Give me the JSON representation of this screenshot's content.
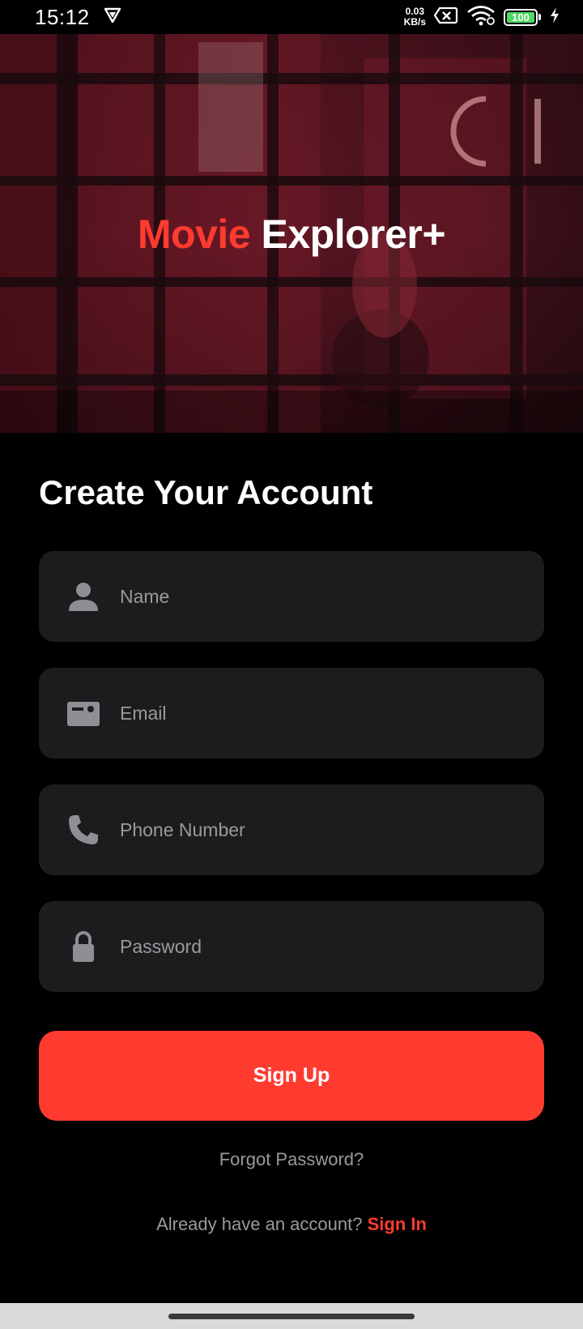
{
  "status_bar": {
    "time": "15:12",
    "net_speed_value": "0.03",
    "net_speed_unit": "KB/s",
    "battery_level": "100",
    "icons": [
      "vpn-shield-icon",
      "no-sim-icon",
      "wifi-icon",
      "battery-icon",
      "charging-icon"
    ]
  },
  "hero": {
    "title_accent": "Movie",
    "title_rest": "Explorer+"
  },
  "form": {
    "title": "Create Your Account",
    "fields": [
      {
        "placeholder": "Name",
        "value": "",
        "icon": "person-icon"
      },
      {
        "placeholder": "Email",
        "value": "",
        "icon": "id-card-icon"
      },
      {
        "placeholder": "Phone Number",
        "value": "",
        "icon": "phone-icon"
      },
      {
        "placeholder": "Password",
        "value": "",
        "icon": "lock-icon"
      }
    ],
    "submit_label": "Sign Up",
    "forgot_label": "Forgot Password?",
    "signin_prompt": "Already have an account?",
    "signin_label": "Sign In"
  },
  "colors": {
    "accent": "#ff3b30",
    "background": "#000000",
    "field_background": "#1c1c1e",
    "muted_text": "#9a9a9e"
  }
}
